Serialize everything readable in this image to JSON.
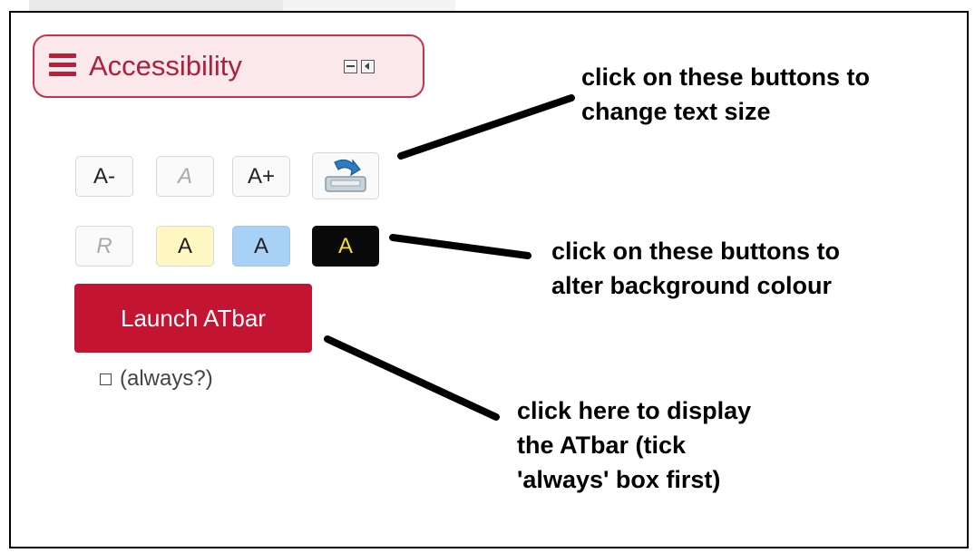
{
  "header": {
    "title": "Accessibility",
    "icons": {
      "menu": "hamburger-icon",
      "minimize": "minimize-icon",
      "collapse": "collapse-icon"
    }
  },
  "text_size_buttons": [
    {
      "label": "A-",
      "state": "enabled"
    },
    {
      "label": "A",
      "state": "disabled"
    },
    {
      "label": "A+",
      "state": "enabled"
    },
    {
      "label": "",
      "icon": "save-download-icon",
      "state": "enabled"
    }
  ],
  "background_buttons": [
    {
      "label": "R",
      "state": "disabled",
      "color": "#fafafa"
    },
    {
      "label": "A",
      "state": "enabled",
      "color": "#fff8c2"
    },
    {
      "label": "A",
      "state": "enabled",
      "color": "#a8d2f5"
    },
    {
      "label": "A",
      "state": "enabled",
      "color": "#0a0a0a",
      "text_color": "#f4df3a"
    }
  ],
  "launch": {
    "label": "Launch ATbar",
    "color": "#c31432"
  },
  "always": {
    "label": "(always?)",
    "checked": false
  },
  "annotations": {
    "text_size": [
      "click on these buttons to",
      "change text size"
    ],
    "background": [
      "click on these buttons to",
      "alter background colour"
    ],
    "launch": [
      "click here to display",
      "the ATbar (tick",
      "'always' box first)"
    ]
  },
  "colors": {
    "accent": "#b0203a",
    "header_bg": "#fbe8ea",
    "header_border": "#c8324a"
  }
}
